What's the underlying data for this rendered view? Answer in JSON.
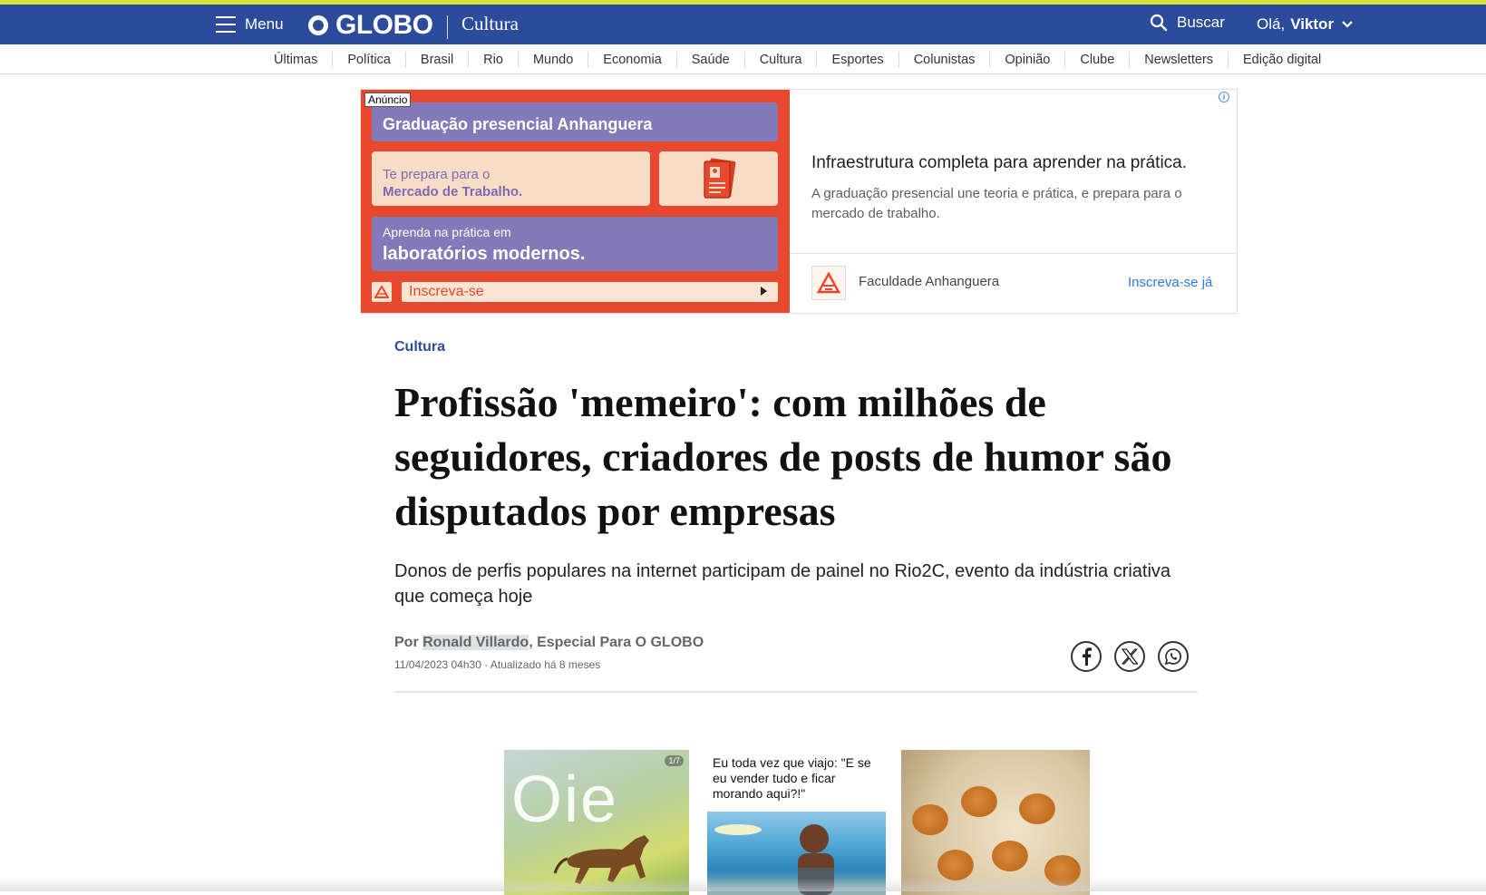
{
  "topbar": {
    "menu_label": "Menu",
    "logo_text": "GLOBO",
    "section": "Cultura",
    "search_label": "Buscar",
    "greeting": "Olá,",
    "user_name": "Viktor"
  },
  "nav": {
    "items": [
      "Últimas",
      "Política",
      "Brasil",
      "Rio",
      "Mundo",
      "Economia",
      "Saúde",
      "Cultura",
      "Esportes",
      "Colunistas",
      "Opinião",
      "Clube",
      "Newsletters",
      "Edição digital"
    ]
  },
  "ad": {
    "badge": "Anúncio",
    "box1": "Graduação presencial Anhanguera",
    "box2_line1": "Te prepara para o",
    "box2_line2": "Mercado de Trabalho.",
    "box4_small": "Aprenda na prática em",
    "box4_large": "laboratórios modernos.",
    "cta_bar": "Inscreva-se",
    "info": "i",
    "headline": "Infraestrutura completa para aprender na prática.",
    "description": "A graduação presencial une teoria e prática, e prepara para o mercado de trabalho.",
    "brand": "Faculdade Anhanguera",
    "link": "Inscreva-se já",
    "brand_color": "#e8492e",
    "purple": "#8479b9"
  },
  "article": {
    "kicker": "Cultura",
    "headline": "Profissão 'memeiro': com milhões de seguidores, criadores de posts de humor são disputados por empresas",
    "subtitle": "Donos de perfis populares na internet participam de painel no Rio2C, evento da indústria criativa que começa hoje",
    "byline_prefix": "Por",
    "author": "Ronald Villardo",
    "byline_suffix": ", Especial Para O GLOBO",
    "dateline": "11/04/2023 04h30 · Atualizado há 8 meses",
    "share_icons": [
      "facebook-icon",
      "x-icon",
      "whatsapp-icon"
    ]
  },
  "gallery": {
    "thumb1_text": "Oie",
    "thumb1_count": "1/7",
    "thumb2_caption": "Eu toda vez que viajo: \"E se eu vender tudo e ficar morando aqui?!\""
  },
  "colors": {
    "header_blue": "#2c4b9a",
    "accent_yellow": "#d8e33a"
  }
}
